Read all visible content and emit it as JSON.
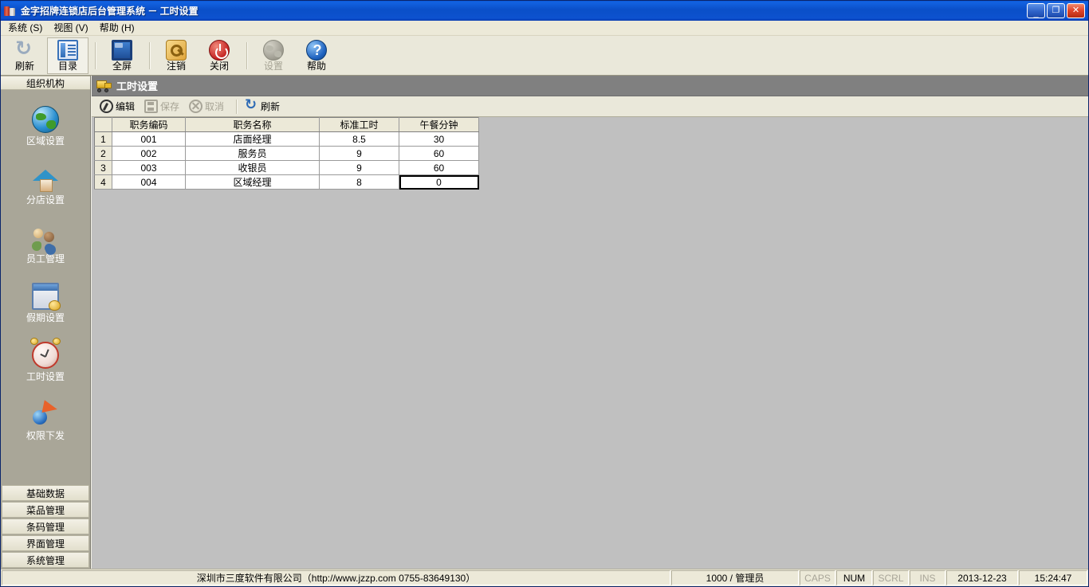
{
  "window": {
    "title": "金字招牌连锁店后台管理系统  －  工时设置",
    "icon": "app-icon",
    "buttons": {
      "minimize": "_",
      "restore": "❐",
      "close": "✕"
    }
  },
  "menu": {
    "items": [
      {
        "label": "系统 (S)",
        "name": "menu-system"
      },
      {
        "label": "视图 (V)",
        "name": "menu-view"
      },
      {
        "label": "帮助 (H)",
        "name": "menu-help"
      }
    ]
  },
  "toolbar": {
    "buttons": [
      {
        "label": "刷新",
        "icon": "refresh-icon",
        "state": "normal"
      },
      {
        "label": "目录",
        "icon": "catalog-icon",
        "state": "selected"
      },
      {
        "label": "全屏",
        "icon": "fullscreen-icon",
        "state": "normal"
      },
      {
        "label": "注销",
        "icon": "key-icon",
        "state": "normal"
      },
      {
        "label": "关闭",
        "icon": "power-icon",
        "state": "normal"
      },
      {
        "label": "设置",
        "icon": "globe-gear-icon",
        "state": "disabled"
      },
      {
        "label": "帮助",
        "icon": "help-icon",
        "state": "normal"
      }
    ]
  },
  "sidebar": {
    "header": "组织机构",
    "items": [
      {
        "label": "区域设置",
        "icon": "globe-icon"
      },
      {
        "label": "分店设置",
        "icon": "house-icon"
      },
      {
        "label": "员工管理",
        "icon": "people-icon"
      },
      {
        "label": "假期设置",
        "icon": "calendar-icon"
      },
      {
        "label": "工时设置",
        "icon": "alarm-clock-icon"
      },
      {
        "label": "权限下发",
        "icon": "permission-icon"
      }
    ],
    "sections": [
      {
        "label": "基础数据"
      },
      {
        "label": "菜品管理"
      },
      {
        "label": "条码管理"
      },
      {
        "label": "界面管理"
      },
      {
        "label": "系统管理"
      }
    ]
  },
  "panel": {
    "title": "工时设置",
    "icon": "truck-icon",
    "actions": [
      {
        "label": "编辑",
        "icon": "pencil-icon",
        "enabled": true
      },
      {
        "label": "保存",
        "icon": "save-icon",
        "enabled": false
      },
      {
        "label": "取消",
        "icon": "cancel-icon",
        "enabled": false
      },
      {
        "label": "刷新",
        "icon": "refresh-icon",
        "enabled": true
      }
    ]
  },
  "grid": {
    "columns": [
      "职务编码",
      "职务名称",
      "标准工时",
      "午餐分钟"
    ],
    "rows": [
      {
        "num": "1",
        "code": "001",
        "name": "店面经理",
        "hours": "8.5",
        "lunch": "30"
      },
      {
        "num": "2",
        "code": "002",
        "name": "服务员",
        "hours": "9",
        "lunch": "60"
      },
      {
        "num": "3",
        "code": "003",
        "name": "收银员",
        "hours": "9",
        "lunch": "60"
      },
      {
        "num": "4",
        "code": "004",
        "name": "区域经理",
        "hours": "8",
        "lunch": "0"
      }
    ],
    "selected_cell": {
      "row": 3,
      "column": "lunch",
      "value": "0"
    }
  },
  "statusbar": {
    "company": "深圳市三度软件有限公司（http://www.jzzp.com  0755-83649130）",
    "user": "1000 / 管理员",
    "caps": "CAPS",
    "num": "NUM",
    "scrl": "SCRL",
    "ins": "INS",
    "date": "2013-12-23",
    "time": "15:24:47"
  },
  "colors": {
    "titlebar_blue": "#0a4fc8",
    "toolbar_cream": "#eae8da",
    "sidebar_taupe": "#a9a698",
    "content_grey": "#c0c0c0",
    "panel_header_grey": "#808080",
    "grid_header_beige": "#ece9d8",
    "close_red": "#e1452a"
  }
}
